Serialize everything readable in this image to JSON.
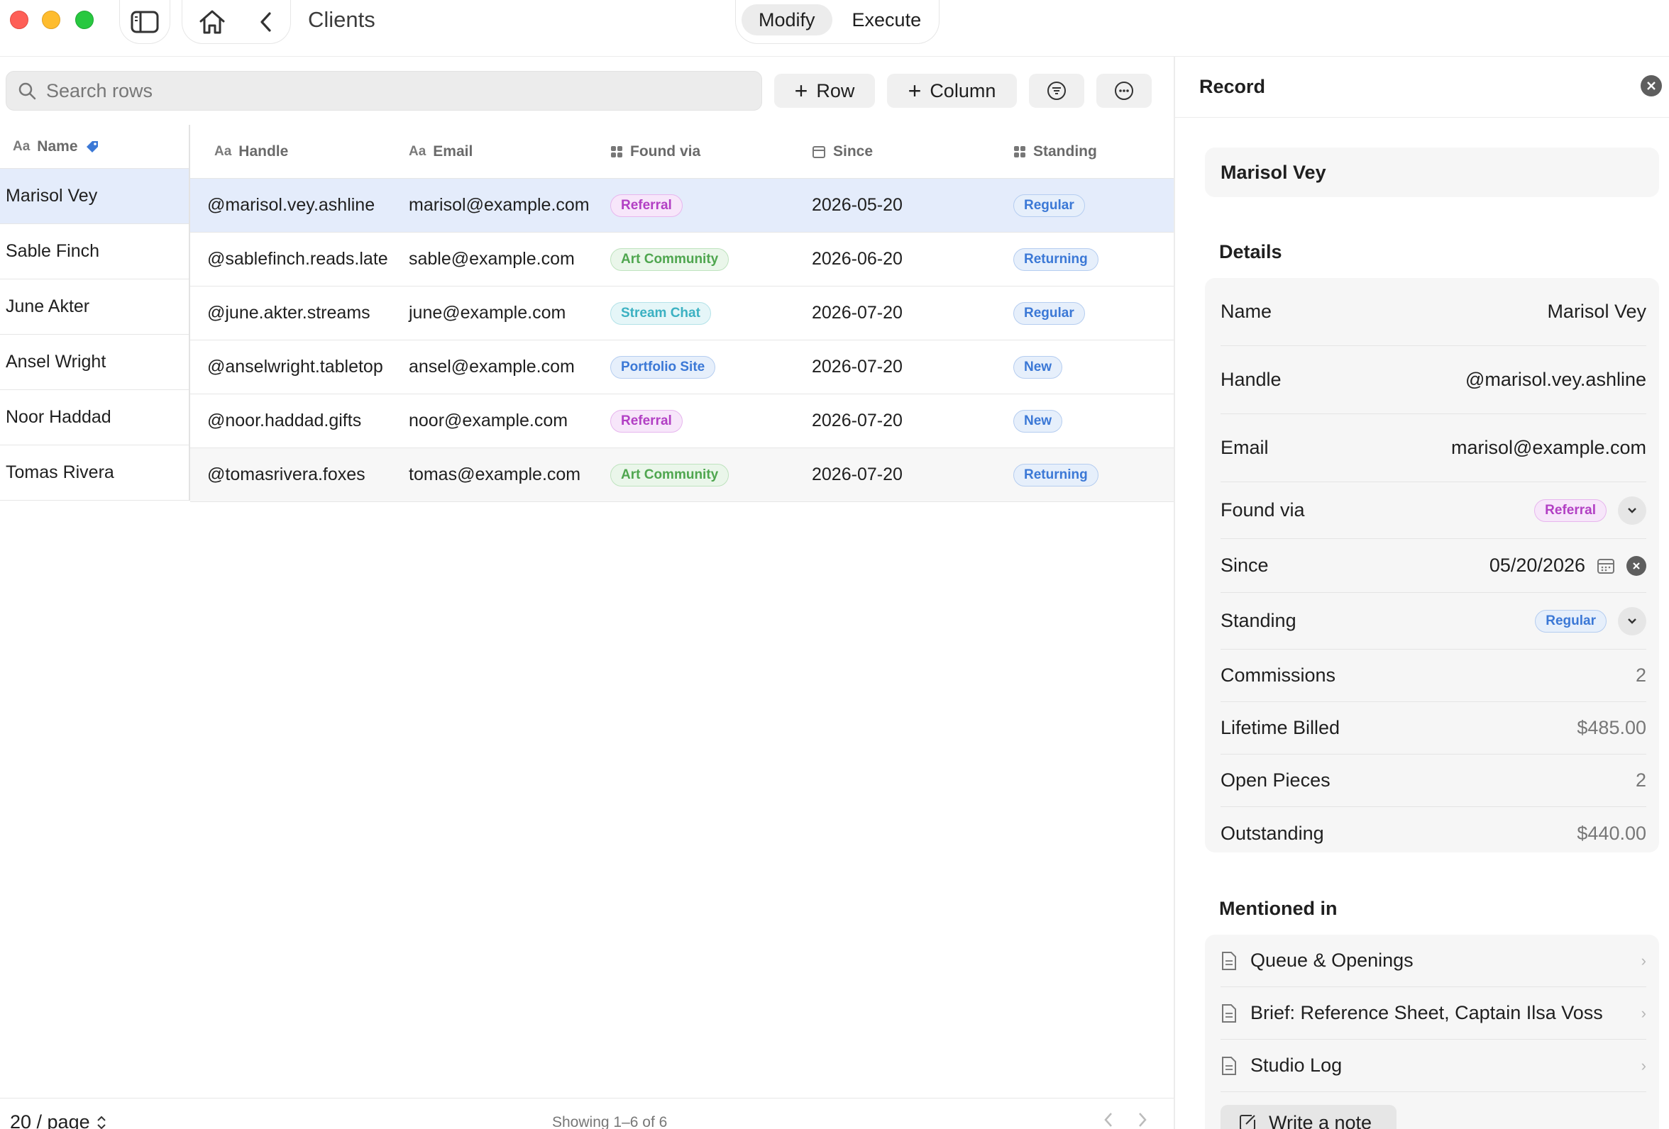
{
  "window": {
    "title": "Clients"
  },
  "mode_tabs": [
    {
      "label": "Modify",
      "active": true
    },
    {
      "label": "Execute",
      "active": false
    }
  ],
  "toolbar": {
    "search_placeholder": "Search rows",
    "add_row_label": "Row",
    "add_column_label": "Column"
  },
  "table": {
    "columns": {
      "name": "Name",
      "handle": "Handle",
      "email": "Email",
      "found_via": "Found via",
      "since": "Since",
      "standing": "Standing"
    },
    "rows": [
      {
        "name": "Marisol Vey",
        "handle": "@marisol.vey.ashline",
        "email": "marisol@example.com",
        "found_via": "Referral",
        "since": "2026-05-20",
        "standing": "Regular"
      },
      {
        "name": "Sable Finch",
        "handle": "@sablefinch.reads.late",
        "email": "sable@example.com",
        "found_via": "Art Community",
        "since": "2026-06-20",
        "standing": "Returning"
      },
      {
        "name": "June Akter",
        "handle": "@june.akter.streams",
        "email": "june@example.com",
        "found_via": "Stream Chat",
        "since": "2026-07-20",
        "standing": "Regular"
      },
      {
        "name": "Ansel Wright",
        "handle": "@anselwright.tabletop",
        "email": "ansel@example.com",
        "found_via": "Portfolio Site",
        "since": "2026-07-20",
        "standing": "New"
      },
      {
        "name": "Noor Haddad",
        "handle": "@noor.haddad.gifts",
        "email": "noor@example.com",
        "found_via": "Referral",
        "since": "2026-07-20",
        "standing": "New"
      },
      {
        "name": "Tomas Rivera",
        "handle": "@tomasrivera.foxes",
        "email": "tomas@example.com",
        "found_via": "Art Community",
        "since": "2026-07-20",
        "standing": "Returning"
      }
    ],
    "selected_row": 0
  },
  "tag_colors": {
    "Referral": {
      "text": "#b23fc4",
      "bg": "#f7e6fa",
      "border": "#e7b6ee"
    },
    "Art Community": {
      "text": "#4fa64f",
      "bg": "#eaf6ea",
      "border": "#bfe3bf"
    },
    "Stream Chat": {
      "text": "#3bb1c2",
      "bg": "#e5f6f8",
      "border": "#b3e2e8"
    },
    "Portfolio Site": {
      "text": "#3b78d6",
      "bg": "#e6effb",
      "border": "#b5cdf0"
    },
    "Regular": {
      "text": "#3b78d6",
      "bg": "#e6effb",
      "border": "#b5cdf0"
    },
    "Returning": {
      "text": "#3b78d6",
      "bg": "#e6effb",
      "border": "#b5cdf0"
    },
    "New": {
      "text": "#3b78d6",
      "bg": "#e6effb",
      "border": "#b5cdf0"
    }
  },
  "footer": {
    "per_page": "20 / page",
    "showing": "Showing 1–6 of 6"
  },
  "record": {
    "header": "Record",
    "name": "Marisol Vey",
    "details_title": "Details",
    "fields": {
      "name_label": "Name",
      "name_value": "Marisol Vey",
      "handle_label": "Handle",
      "handle_value": "@marisol.vey.ashline",
      "email_label": "Email",
      "email_value": "marisol@example.com",
      "found_label": "Found via",
      "found_value": "Referral",
      "since_label": "Since",
      "since_value": "05/20/2026",
      "standing_label": "Standing",
      "standing_value": "Regular",
      "commissions_label": "Commissions",
      "commissions_value": "2",
      "billed_label": "Lifetime Billed",
      "billed_value": "$485.00",
      "open_label": "Open Pieces",
      "open_value": "2",
      "outstanding_label": "Outstanding",
      "outstanding_value": "$440.00"
    },
    "mentions_title": "Mentioned in",
    "mentions": [
      "Queue & Openings",
      "Brief: Reference Sheet, Captain Ilsa Voss",
      "Studio Log"
    ],
    "write_note_label": "Write a note"
  },
  "icons": {
    "search": "search-icon",
    "home": "home-icon",
    "back": "chevron-left-icon",
    "sidebar": "sidebar-icon",
    "filter": "filter-icon",
    "more": "more-icon",
    "close": "close-icon",
    "calendar": "calendar-icon",
    "document": "document-icon",
    "compose": "compose-icon"
  }
}
